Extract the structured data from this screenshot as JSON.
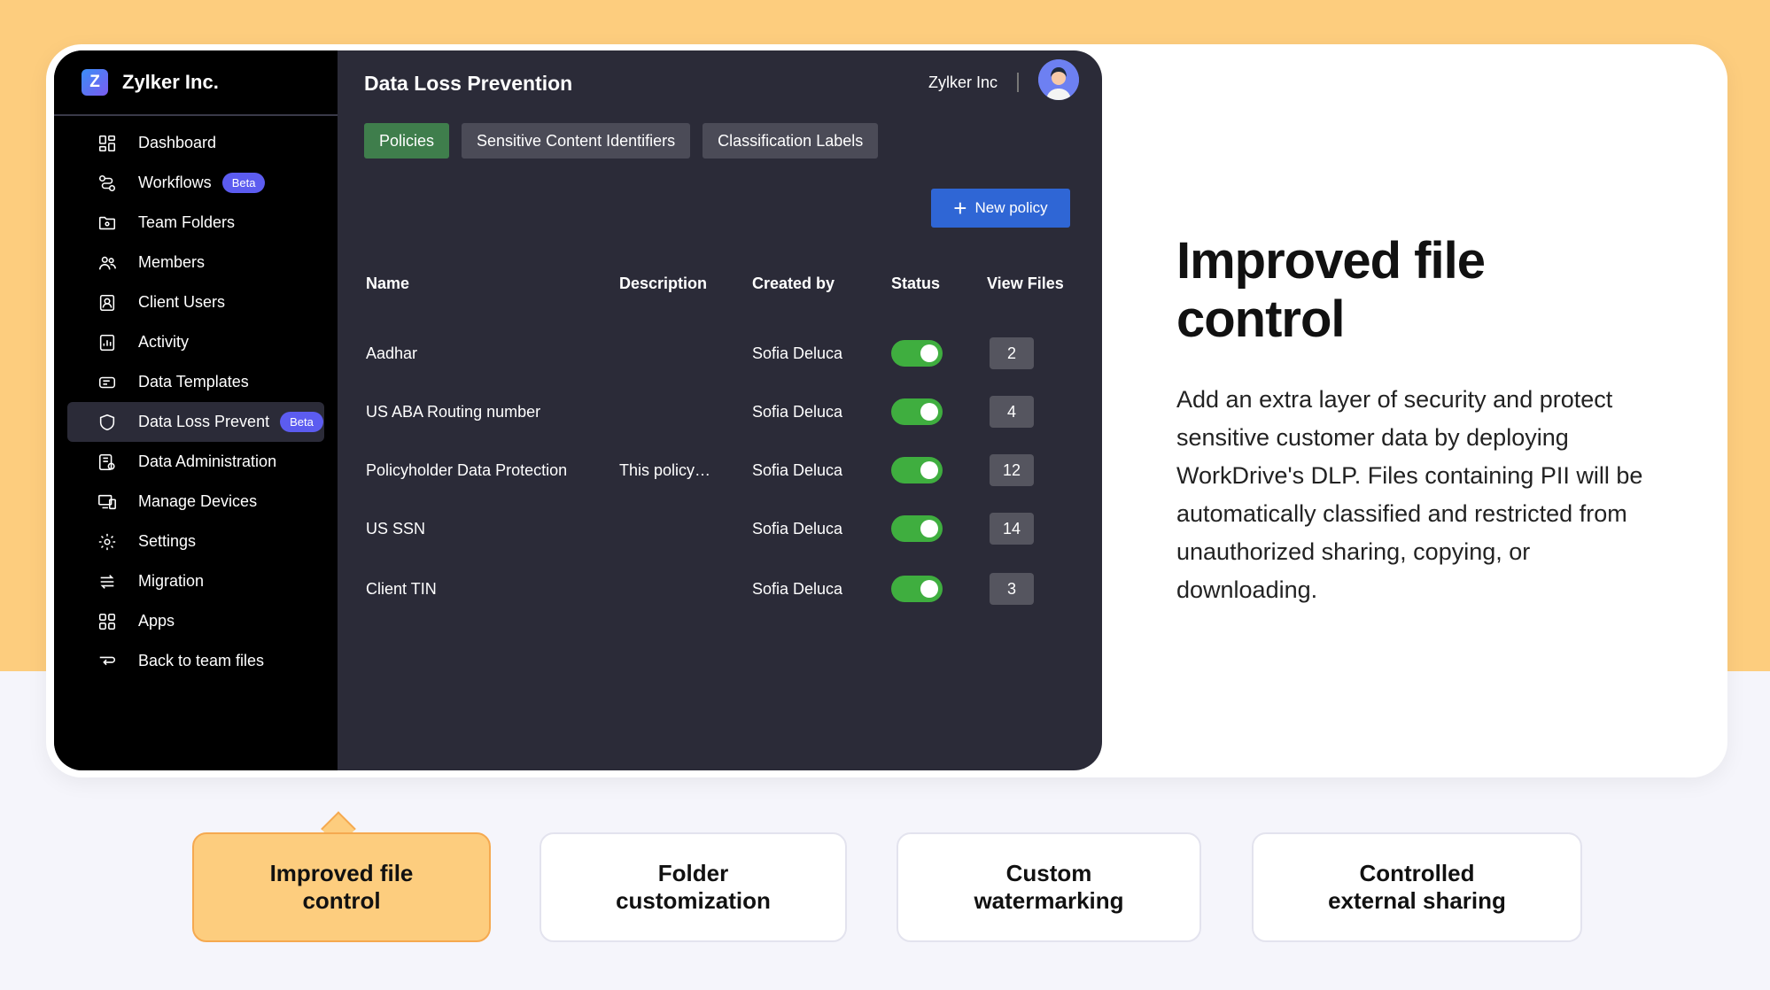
{
  "app": {
    "brand_initial": "Z",
    "brand_name": "Zylker Inc.",
    "title": "Data Loss Prevention",
    "org_name": "Zylker Inc"
  },
  "sidebar": {
    "items": [
      {
        "label": "Dashboard",
        "icon": "dashboard-icon"
      },
      {
        "label": "Workflows",
        "icon": "workflow-icon",
        "badge": "Beta"
      },
      {
        "label": "Team Folders",
        "icon": "team-folder-icon"
      },
      {
        "label": "Members",
        "icon": "members-icon"
      },
      {
        "label": "Client Users",
        "icon": "client-user-icon"
      },
      {
        "label": "Activity",
        "icon": "activity-icon"
      },
      {
        "label": "Data Templates",
        "icon": "data-template-icon"
      },
      {
        "label": "Data Loss Prevent",
        "icon": "shield-icon",
        "badge": "Beta",
        "active": true
      },
      {
        "label": "Data Administration",
        "icon": "data-admin-icon"
      },
      {
        "label": "Manage Devices",
        "icon": "devices-icon"
      },
      {
        "label": "Settings",
        "icon": "gear-icon"
      },
      {
        "label": "Migration",
        "icon": "migration-icon"
      },
      {
        "label": "Apps",
        "icon": "apps-icon"
      },
      {
        "label": "Back to team files",
        "icon": "back-icon"
      }
    ]
  },
  "tabs": [
    {
      "label": "Policies",
      "active": true
    },
    {
      "label": "Sensitive Content Identifiers"
    },
    {
      "label": "Classification Labels"
    }
  ],
  "new_policy_label": "New policy",
  "table": {
    "headers": [
      "Name",
      "Description",
      "Created by",
      "Status",
      "View Files"
    ],
    "rows": [
      {
        "name": "Aadhar",
        "description": "",
        "created_by": "Sofia Deluca",
        "status": "on",
        "files": "2"
      },
      {
        "name": "US ABA Routing number",
        "description": "",
        "created_by": "Sofia Deluca",
        "status": "on",
        "files": "4"
      },
      {
        "name": "Policyholder Data Protection",
        "description": "This policy…",
        "created_by": "Sofia Deluca",
        "status": "on",
        "files": "12"
      },
      {
        "name": "US SSN",
        "description": "",
        "created_by": "Sofia Deluca",
        "status": "on",
        "files": "14"
      },
      {
        "name": "Client TIN",
        "description": "",
        "created_by": "Sofia Deluca",
        "status": "on",
        "files": "3"
      }
    ]
  },
  "marketing": {
    "headline_line1": "Improved file",
    "headline_line2": "control",
    "description": "Add an extra layer of security and protect sensitive customer data by deploying WorkDrive's DLP. Files containing PII will be automatically classified and restricted from unauthorized sharing, copying, or downloading."
  },
  "features": [
    {
      "line1": "Improved file",
      "line2": "control",
      "active": true
    },
    {
      "line1": "Folder",
      "line2": "customization"
    },
    {
      "line1": "Custom",
      "line2": "watermarking"
    },
    {
      "line1": "Controlled",
      "line2": "external sharing"
    }
  ],
  "colors": {
    "accent_orange": "#fdcd7e",
    "toggle_green": "#3fae3f",
    "primary_blue": "#2f66d5",
    "beta_purple": "#5c5cf0",
    "active_tab_green": "#3f7e4c"
  }
}
